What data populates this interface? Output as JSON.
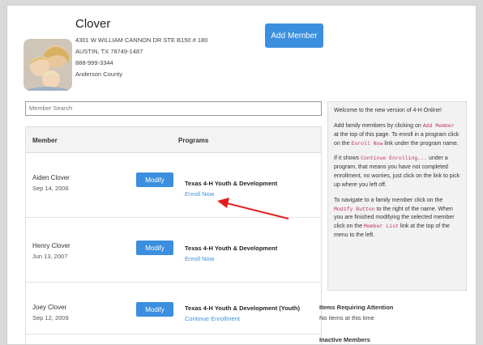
{
  "family": {
    "name": "Clover",
    "address1": "4301 W WILLIAM CANNON DR STE B150 # 180",
    "address2": "AUSTIN, TX 78749-1487",
    "phone": "888-999-3344",
    "county": "Anderson County"
  },
  "add_member_label": "Add Member",
  "search": {
    "placeholder": "Member Search"
  },
  "table": {
    "header_member": "Member",
    "header_programs": "Programs",
    "modify_label": "Modify",
    "rows": [
      {
        "name": "Aiden Clover",
        "dob": "Sep 14, 2006",
        "program": "Texas 4-H Youth & Development",
        "link": "Enroll Now"
      },
      {
        "name": "Henry Clover",
        "dob": "Jun 13, 2007",
        "program": "Texas 4-H Youth & Development",
        "link": "Enroll Now"
      },
      {
        "name": "Joey Clover",
        "dob": "Sep 12, 2009",
        "program": "Texas 4-H Youth & Development (Youth)",
        "link": "Continue Enrollment"
      }
    ]
  },
  "sidebar": {
    "welcome": "Welcome to the new version of 4-H Online!",
    "p2_a": "Add family members by clicking on ",
    "p2_code1": "Add Member",
    "p2_b": " at the top of this page. To enroll in a program click on the ",
    "p2_code2": "Enroll Now",
    "p2_c": " link under the program name.",
    "p3_a": "If it shows ",
    "p3_code": "Continue Enrolling...",
    "p3_b": " under a program, that means you have not completed enrollment, no worries, just click on the link to pick up where you left off.",
    "p4_a": "To navigate to a family member click on the ",
    "p4_code1": "Modify Button",
    "p4_b": " to the right of the name. When you are finished modifying the selected member click on the ",
    "p4_code2": "Member List",
    "p4_c": " link at the top of the menu to the left."
  },
  "attention": {
    "title": "Items Requiring Attention",
    "text": "No items at this time"
  },
  "inactive_title": "Inactive Members",
  "colors": {
    "accent": "#3b8fde",
    "code": "#c0306b",
    "annotation_arrow": "#e02020"
  }
}
